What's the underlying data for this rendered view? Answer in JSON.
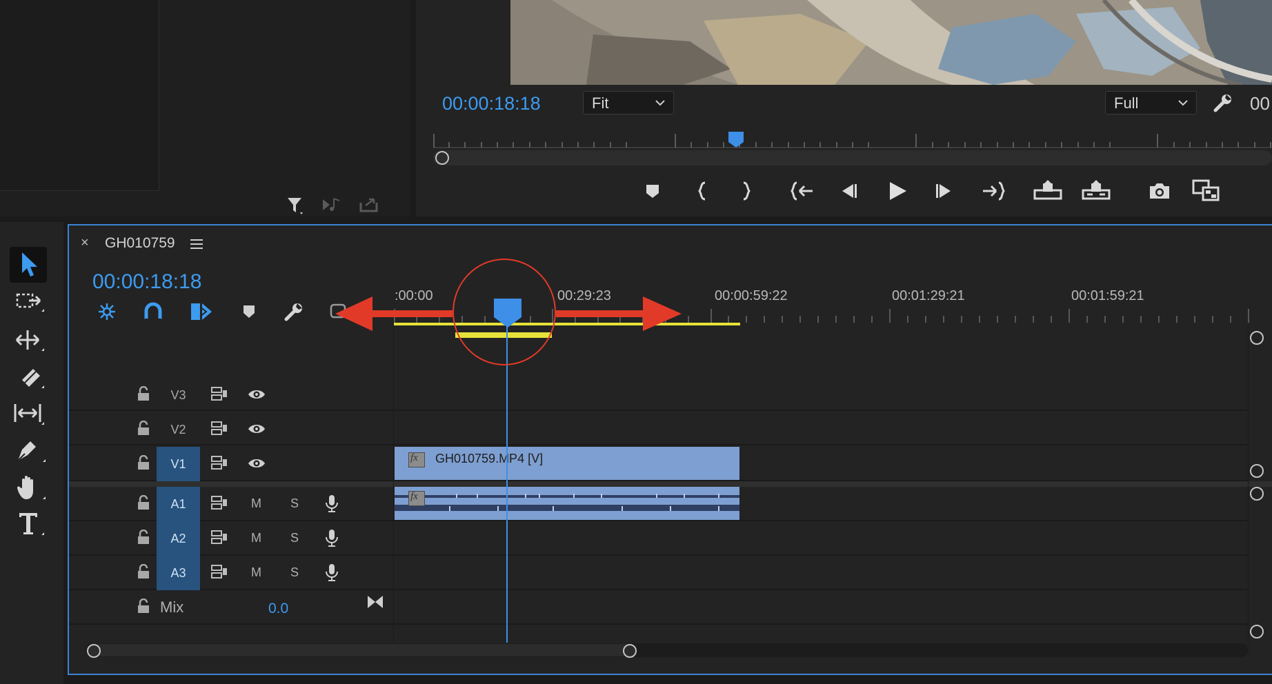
{
  "program_monitor": {
    "timecode": "00:00:18:18",
    "fit_dropdown": "Fit",
    "quality_dropdown": "Full",
    "right_timecode_partial": "00"
  },
  "timeline": {
    "close_label": "×",
    "sequence_name": "GH010759",
    "timecode": "00:00:18:18",
    "ruler_labels": [
      ":00:00",
      "00:29:23",
      "00:00:59:22",
      "00:01:29:21",
      "00:01:59:21"
    ],
    "tracks": {
      "v3": "V3",
      "v2": "V2",
      "v1": "V1",
      "a1": "A1",
      "a2": "A2",
      "a3": "A3",
      "mix": "Mix",
      "mix_value": "0.0",
      "mute_label": "M",
      "solo_label": "S"
    },
    "video_clip": {
      "fx_label": "fx",
      "name": "GH010759.MP4 [V]"
    },
    "audio_clip": {
      "fx_label": "fx"
    }
  },
  "colors": {
    "accent_blue": "#3d9bf0",
    "clip_video": "#7e9fd1",
    "work_area_yellow": "#e7e23a",
    "annotation_red": "#e23a28",
    "panel_bg": "#232323",
    "selection_border": "#3b83d6"
  },
  "icons": [
    "filter-icon",
    "insert-icon",
    "export-icon",
    "marker-icon",
    "mark-in-icon",
    "mark-out-icon",
    "go-to-in-icon",
    "step-back-icon",
    "play-icon",
    "step-forward-icon",
    "go-to-out-icon",
    "lift-icon",
    "extract-icon",
    "camera-icon",
    "compare-icon",
    "wrench-icon",
    "selection-tool-icon",
    "track-select-icon",
    "ripple-edit-icon",
    "razor-icon",
    "slip-icon",
    "pen-icon",
    "hand-icon",
    "type-icon",
    "lock-icon",
    "sync-icon",
    "eye-icon",
    "mic-icon"
  ]
}
